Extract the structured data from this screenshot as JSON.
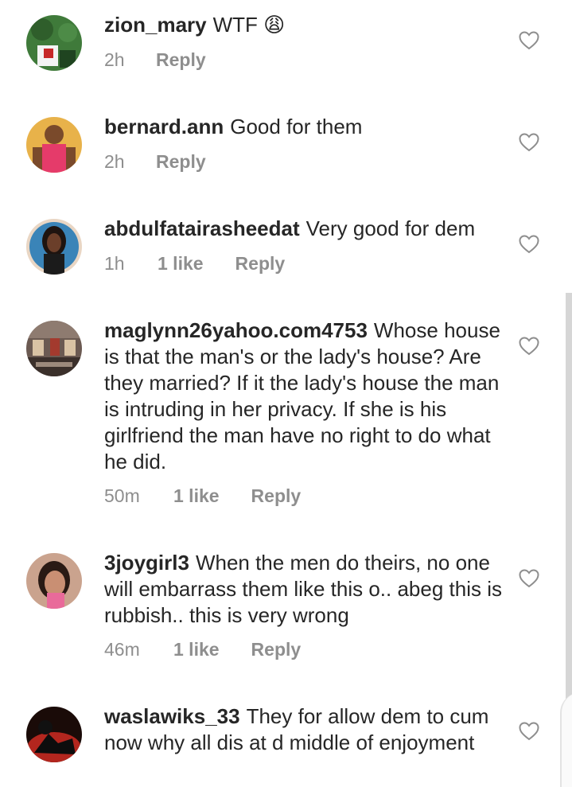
{
  "comments": [
    {
      "username": "zion_mary",
      "text": "WTF 😩",
      "time": "2h",
      "likes": "",
      "reply": "Reply"
    },
    {
      "username": "bernard.ann",
      "text": "Good for them",
      "time": "2h",
      "likes": "",
      "reply": "Reply"
    },
    {
      "username": "abdulfatairasheedat",
      "text": "Very good for dem",
      "time": "1h",
      "likes": "1 like",
      "reply": "Reply"
    },
    {
      "username": "maglynn26yahoo.com4753",
      "text": "Whose house is that the man's or the lady's house? Are they married? If it the lady's house the man is intruding in her privacy. If she is his girlfriend the man have no right to do what he did.",
      "time": "50m",
      "likes": "1 like",
      "reply": "Reply"
    },
    {
      "username": "3joygirl3",
      "text": "When the men do theirs, no one will embarrass them like this o.. abeg this is rubbish.. this is very wrong",
      "time": "46m",
      "likes": "1 like",
      "reply": "Reply"
    },
    {
      "username": "waslawiks_33",
      "text": "They for allow dem to cum now why all dis at d middle of enjoyment",
      "time": "",
      "likes": "",
      "reply": ""
    }
  ]
}
